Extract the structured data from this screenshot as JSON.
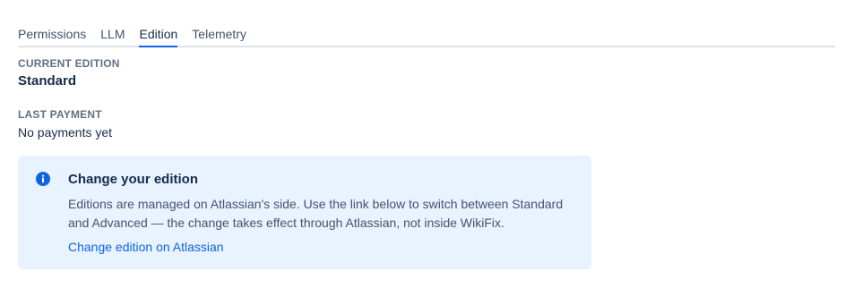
{
  "tabs": [
    {
      "label": "Permissions",
      "active": false
    },
    {
      "label": "LLM",
      "active": false
    },
    {
      "label": "Edition",
      "active": true
    },
    {
      "label": "Telemetry",
      "active": false
    }
  ],
  "current_edition": {
    "label": "CURRENT EDITION",
    "value": "Standard"
  },
  "last_payment": {
    "label": "LAST PAYMENT",
    "value": "No payments yet"
  },
  "info_panel": {
    "icon": "info-icon",
    "title": "Change your edition",
    "body": "Editions are managed on Atlassian's side. Use the link below to switch between Standard and Advanced — the change takes effect through Atlassian, not inside WikiFix.",
    "link_label": "Change edition on Atlassian"
  },
  "colors": {
    "accent": "#0c66e4",
    "panel_background": "#e9f2ff",
    "label_gray": "#626f86"
  }
}
